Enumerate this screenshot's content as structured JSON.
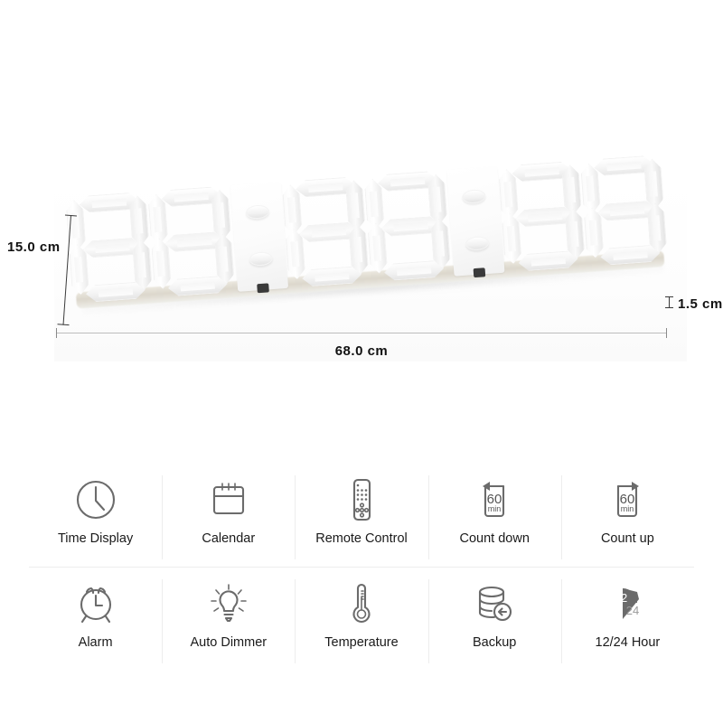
{
  "product": {
    "type": "3D LED digital wall clock",
    "digits_shown": "888888",
    "separator_count": 2,
    "dimensions": {
      "height_label": "15.0 cm",
      "width_label": "68.0 cm",
      "depth_label": "1.5 cm"
    }
  },
  "features": {
    "rows": 2,
    "columns": 5,
    "items": [
      {
        "label": "Time Display",
        "icon": "clock-icon"
      },
      {
        "label": "Calendar",
        "icon": "calendar-icon"
      },
      {
        "label": "Remote Control",
        "icon": "remote-control-icon"
      },
      {
        "label": "Count down",
        "icon": "countdown-timer-icon",
        "badge_value": "60",
        "badge_unit": "min",
        "arrow": "left"
      },
      {
        "label": "Count up",
        "icon": "countup-timer-icon",
        "badge_value": "60",
        "badge_unit": "min",
        "arrow": "right"
      },
      {
        "label": "Alarm",
        "icon": "alarm-clock-icon"
      },
      {
        "label": "Auto Dimmer",
        "icon": "light-bulb-icon"
      },
      {
        "label": "Temperature",
        "icon": "thermometer-icon"
      },
      {
        "label": "Backup",
        "icon": "database-backup-icon"
      },
      {
        "label": "12/24 Hour",
        "icon": "twelve-twentyfour-pie-icon",
        "pie_inner": "12",
        "pie_outer": "24"
      }
    ]
  },
  "colors": {
    "background": "#ffffff",
    "icon_stroke": "#6b6b6b",
    "label_text": "#1a1a1a",
    "divider": "#ededed",
    "dimension_text": "#111111"
  }
}
